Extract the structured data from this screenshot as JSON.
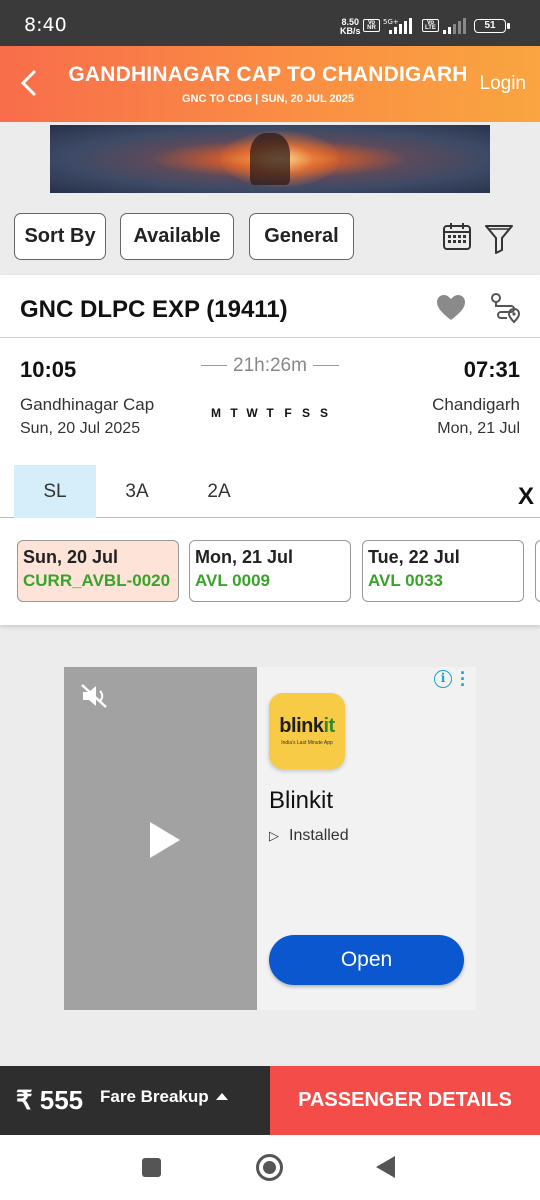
{
  "status_bar": {
    "time": "8:40",
    "net_speed_value": "8.50",
    "net_speed_unit": "KB/s",
    "vo_nr": "Vo NR",
    "signal_5g": "5G+",
    "vo_lte": "Vo LTE",
    "battery": "51"
  },
  "header": {
    "title": "GANDHINAGAR CAP TO CHANDIGARH",
    "subtitle": "GNC TO CDG | SUN, 20 JUL  2025",
    "login_label": "Login",
    "colors": {
      "start": "#f86d4b",
      "end": "#f9a540"
    }
  },
  "filters": {
    "sort_label": "Sort By",
    "available_label": "Available",
    "quota_label": "General",
    "icons": [
      "calendar-icon",
      "filter-icon"
    ]
  },
  "train": {
    "name": "GNC DLPC EXP (19411)",
    "departure_time": "10:05",
    "arrival_time": "07:31",
    "duration": "21h:26m",
    "run_days": [
      "M",
      "T",
      "W",
      "T",
      "F",
      "S",
      "S"
    ],
    "from_station": "Gandhinagar Cap",
    "to_station": "Chandigarh",
    "departure_date": "Sun, 20 Jul  2025",
    "arrival_date": "Mon, 21 Jul",
    "classes": [
      "SL",
      "3A",
      "2A"
    ],
    "selected_class": "SL",
    "close_label": "X",
    "availability": [
      {
        "date": "Sun, 20 Jul",
        "status": "CURR_AVBL-0020"
      },
      {
        "date": "Mon, 21 Jul",
        "status": "AVL 0009"
      },
      {
        "date": "Tue, 22 Jul",
        "status": "AVL 0033"
      }
    ],
    "available_color": "#3aa32c"
  },
  "ad": {
    "app_name": "Blinkit",
    "logo_text_a": "blink",
    "logo_text_b": "it",
    "logo_tagline": "India's Last Minute App",
    "installed_label": "Installed",
    "open_label": "Open",
    "info_label": "i",
    "open_color": "#0b57d0"
  },
  "bottom_bar": {
    "price": "₹ 555",
    "fare_breakup_label": "Fare Breakup",
    "passenger_label": "PASSENGER DETAILS",
    "passenger_color": "#f44c49"
  }
}
